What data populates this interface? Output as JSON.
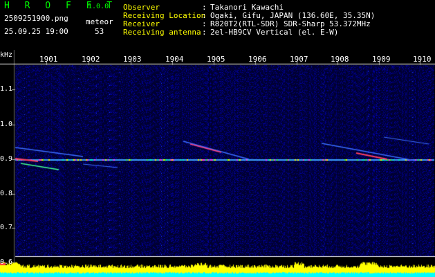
{
  "header": {
    "app_name": "H R O F F T",
    "version": "1.0.0",
    "filename": "2509251900.png",
    "timestamp": "25.09.25 19:00",
    "meteor_label": "meteor",
    "meteor_count": "53",
    "info": [
      {
        "key": "Observer",
        "value": "Takanori Kawachi"
      },
      {
        "key": "Receiving Location",
        "value": "Ogaki, Gifu, JAPAN (136.60E, 35.35N)"
      },
      {
        "key": "Receiver",
        "value": "R820T2(RTL-SDR) SDR-Sharp 53.372MHz"
      },
      {
        "key": "Receiving antenna",
        "value": "2el-HB9CV Vertical (el. E-W)"
      }
    ],
    "separator": ":"
  },
  "axes": {
    "y_unit": "kHz",
    "y_ticks": [
      "1.1",
      "1.0",
      "0.9",
      "0.8",
      "0.7",
      "0.6"
    ],
    "x_ticks": [
      "1901",
      "1902",
      "1903",
      "1904",
      "1905",
      "1906",
      "1907",
      "1908",
      "1909",
      "1910"
    ]
  },
  "colors": {
    "logo": "#00ff00",
    "info_key": "#ffff00",
    "text": "#ffffff",
    "background": "#000000",
    "noise": "#000080",
    "signal_level": "#ffff00",
    "signal_base": "#00ffff"
  }
}
